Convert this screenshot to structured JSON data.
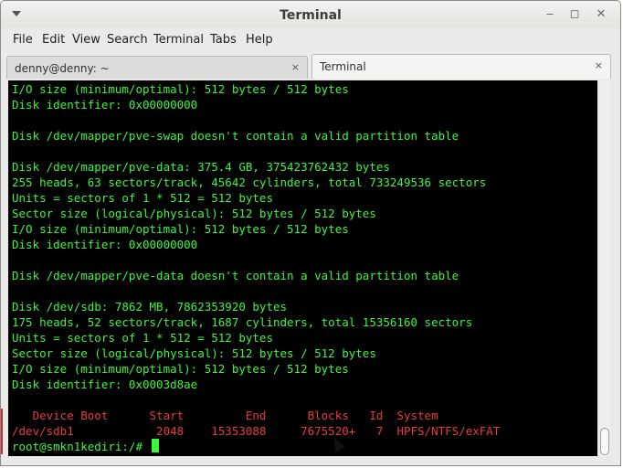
{
  "window": {
    "title": "Terminal"
  },
  "menu": [
    "File",
    "Edit",
    "View",
    "Search",
    "Terminal",
    "Tabs",
    "Help"
  ],
  "tabs": [
    {
      "label": "denny@denny: ~",
      "close": "×"
    },
    {
      "label": "Terminal",
      "close": "×"
    }
  ],
  "window_buttons": {
    "minimize": "‒",
    "maximize": "◻",
    "close": "✕"
  },
  "terminal": {
    "lines": [
      "I/O size (minimum/optimal): 512 bytes / 512 bytes",
      "Disk identifier: 0x00000000",
      "",
      "Disk /dev/mapper/pve-swap doesn't contain a valid partition table",
      "",
      "Disk /dev/mapper/pve-data: 375.4 GB, 375423762432 bytes",
      "255 heads, 63 sectors/track, 45642 cylinders, total 733249536 sectors",
      "Units = sectors of 1 * 512 = 512 bytes",
      "Sector size (logical/physical): 512 bytes / 512 bytes",
      "I/O size (minimum/optimal): 512 bytes / 512 bytes",
      "Disk identifier: 0x00000000",
      "",
      "Disk /dev/mapper/pve-data doesn't contain a valid partition table",
      "",
      "Disk /dev/sdb: 7862 MB, 7862353920 bytes",
      "175 heads, 52 sectors/track, 1687 cylinders, total 15356160 sectors",
      "Units = sectors of 1 * 512 = 512 bytes",
      "Sector size (logical/physical): 512 bytes / 512 bytes",
      "I/O size (minimum/optimal): 512 bytes / 512 bytes",
      "Disk identifier: 0x0003d8ae",
      "",
      "   Device Boot      Start         End      Blocks   Id  System",
      "/dev/sdb1            2048    15353088     7675520+   7  HPFS/NTFS/exFAT"
    ],
    "prompt": "root@smkn1kediri:/# "
  },
  "colors": {
    "terminal_bg": "#000000",
    "text": "#3ef53e",
    "partition_table": "#e83b3b"
  },
  "icons": [
    "window-menu-icon",
    "minimize-icon",
    "maximize-icon",
    "close-icon",
    "tab-close-icon",
    "mouse-pointer-icon"
  ]
}
